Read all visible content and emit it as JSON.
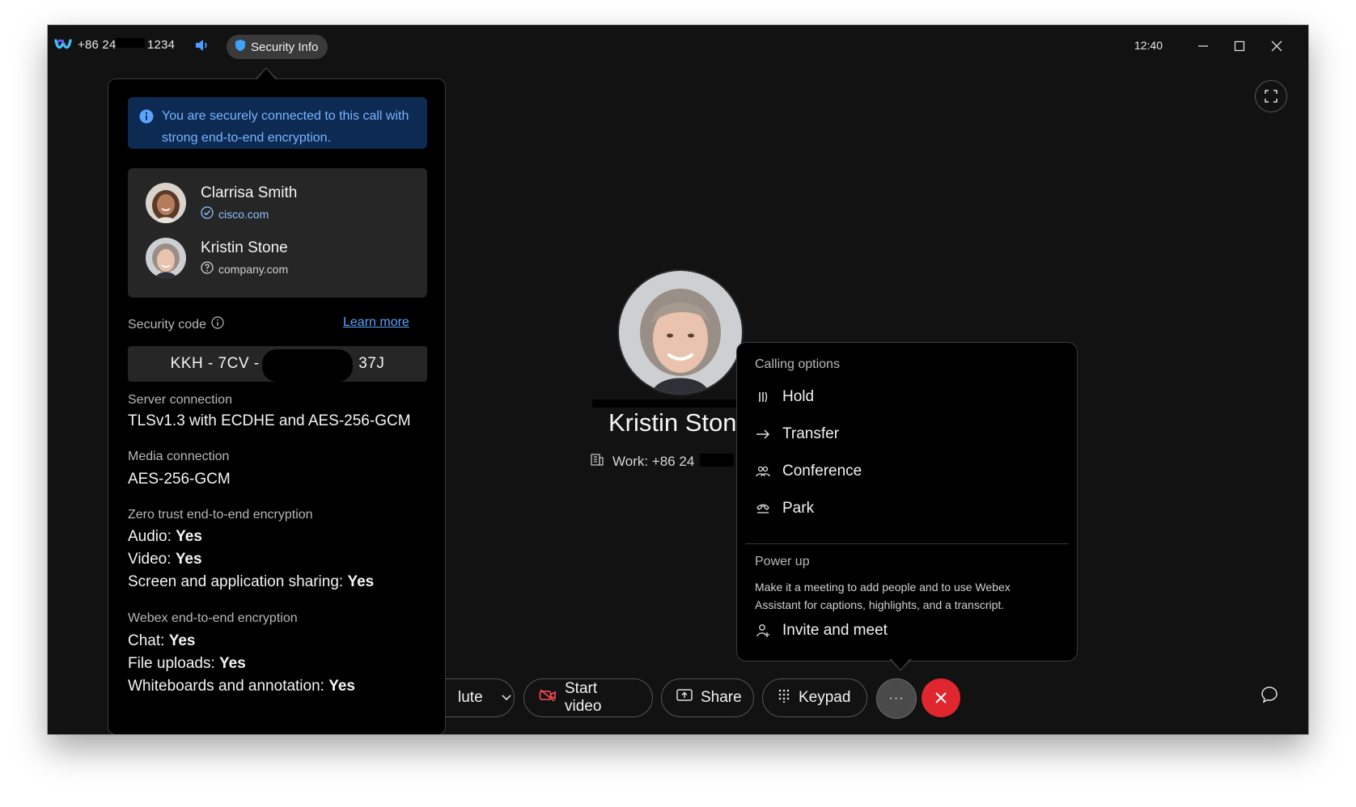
{
  "titlebar": {
    "phone_prefix": "+86 24",
    "phone_suffix": "1234",
    "security_info_label": "Security Info",
    "time": "12:40"
  },
  "security_panel": {
    "banner_text": "You are securely connected to this call with strong end-to-end encryption.",
    "participants": [
      {
        "name": "Clarrisa Smith",
        "domain": "cisco.com",
        "status_icon": "verified-check-icon"
      },
      {
        "name": "Kristin Stone",
        "domain": "company.com",
        "status_icon": "unverified-question-icon"
      }
    ],
    "security_code_label": "Security code",
    "learn_more_label": "Learn more",
    "security_code_start": "KKH - 7CV -",
    "security_code_end": "- 37J",
    "server_connection_label": "Server connection",
    "server_connection_value": "TLSv1.3 with ECDHE and AES-256-GCM",
    "media_connection_label": "Media connection",
    "media_connection_value": "AES-256-GCM",
    "zero_trust_label": "Zero trust end-to-end encryption",
    "audio_label": "Audio:",
    "audio_value": "Yes",
    "video_label": "Video:",
    "video_value": "Yes",
    "screen_sharing_label": "Screen and application sharing:",
    "screen_sharing_value": "Yes",
    "webex_e2e_label": "Webex end-to-end encryption",
    "chat_label": "Chat:",
    "chat_value": "Yes",
    "file_uploads_label": "File uploads:",
    "file_uploads_value": "Yes",
    "whiteboards_label": "Whiteboards and annotation:",
    "whiteboards_value": "Yes"
  },
  "caller": {
    "name": "Kristin Stone",
    "work_label": "Work: +86 24"
  },
  "calling_options": {
    "header": "Calling options",
    "items": [
      {
        "label": "Hold",
        "icon": "hold-icon"
      },
      {
        "label": "Transfer",
        "icon": "transfer-arrow-icon"
      },
      {
        "label": "Conference",
        "icon": "conference-icon"
      },
      {
        "label": "Park",
        "icon": "park-icon"
      }
    ],
    "power_up_header": "Power up",
    "power_up_desc": "Make it a meeting to add people and to use Webex Assistant for captions, highlights, and a transcript.",
    "invite_label": "Invite and meet"
  },
  "controls": {
    "mute_label_partial": "lute",
    "start_video_label": "Start video",
    "share_label": "Share",
    "keypad_label": "Keypad",
    "more_label": "···"
  },
  "colors": {
    "window_bg": "#121212",
    "banner_bg": "#0d2a52",
    "link_blue": "#5aa3ff",
    "end_call_red": "#e0262e",
    "webex_logo": "#3ec6ff"
  }
}
